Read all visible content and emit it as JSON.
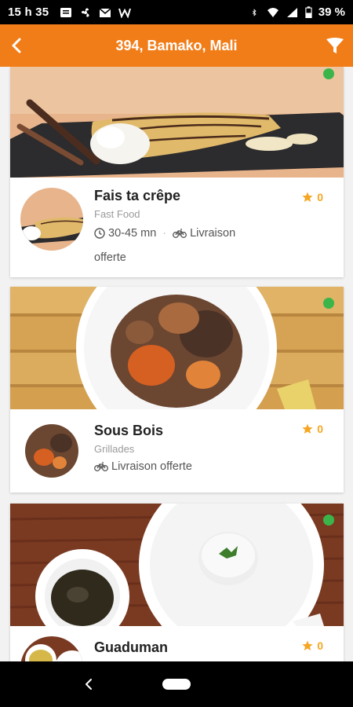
{
  "status_bar": {
    "time": "15 h 35",
    "left_icons": [
      "message-icon",
      "fan-icon",
      "mail-icon",
      "w-icon"
    ],
    "battery": "39 %"
  },
  "header": {
    "title": "394, Bamako, Mali",
    "color": "#f17d19"
  },
  "restaurants": [
    {
      "name": "Fais ta crêpe",
      "category": "Fast Food",
      "time": "30-45 mn",
      "separator": "·",
      "delivery": "Livraison",
      "delivery_wrap": "offerte",
      "rating": "0",
      "online": true
    },
    {
      "name": "Sous Bois",
      "category": "Grillades",
      "delivery": "Livraison offerte",
      "rating": "0",
      "online": true
    },
    {
      "name": "Guaduman",
      "rating": "0",
      "online": true
    }
  ],
  "colors": {
    "accent": "#f17d19",
    "online": "#3bb54a",
    "star": "#f5a623"
  }
}
